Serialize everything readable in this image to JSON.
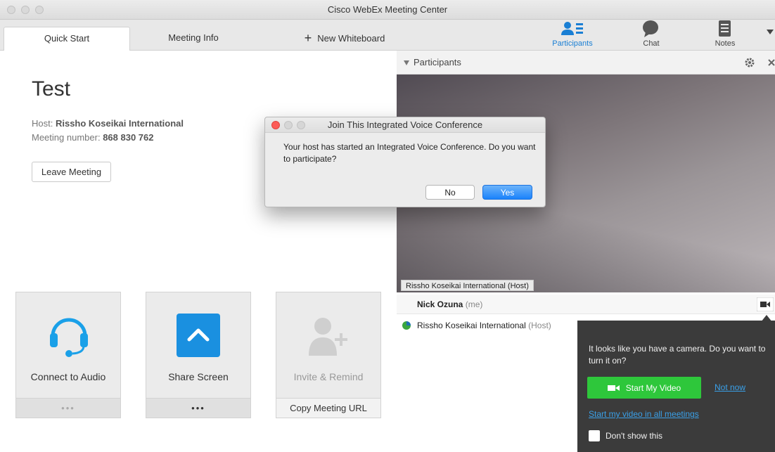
{
  "window": {
    "title": "Cisco WebEx Meeting Center"
  },
  "tabs": [
    {
      "label": "Quick Start"
    },
    {
      "label": "Meeting Info"
    },
    {
      "label": "New Whiteboard"
    }
  ],
  "toolbar": {
    "participants": "Participants",
    "chat": "Chat",
    "notes": "Notes"
  },
  "meeting": {
    "title": "Test",
    "host_label": "Host:",
    "host_name": "Rissho Koseikai International",
    "number_label": "Meeting number:",
    "number": "868 830 762",
    "leave_button": "Leave Meeting"
  },
  "tiles": {
    "audio": {
      "label": "Connect to Audio",
      "footer": "•••"
    },
    "share": {
      "label": "Share Screen",
      "footer": "•••"
    },
    "invite": {
      "label": "Invite & Remind",
      "footer": "Copy Meeting URL"
    }
  },
  "panel": {
    "title": "Participants",
    "video_label": "Rissho Koseikai International (Host)",
    "participants": [
      {
        "name": "Nick Ozuna",
        "role": "(me)"
      },
      {
        "name": "Rissho Koseikai International",
        "role": "(Host)"
      }
    ]
  },
  "dialog": {
    "title": "Join This Integrated Voice Conference",
    "message": "Your host has started an Integrated Voice Conference. Do you want to participate?",
    "no": "No",
    "yes": "Yes"
  },
  "camera_popup": {
    "message": "It looks like you have a camera. Do you want to turn it on?",
    "start_button": "Start My Video",
    "not_now": "Not now",
    "all_meetings": "Start my video in all meetings",
    "dont_show": "Don't show this"
  },
  "colors": {
    "accent": "#1a7fd4",
    "green": "#2ec73b",
    "popup_bg": "#3b3b3b"
  }
}
